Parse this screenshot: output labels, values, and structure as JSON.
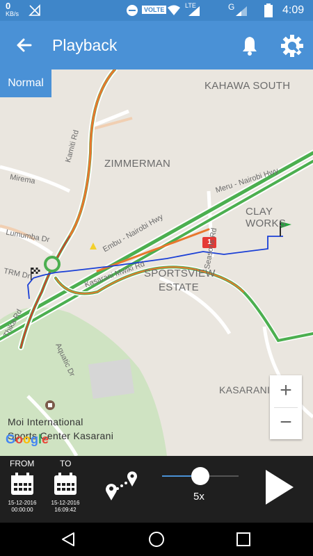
{
  "status_bar": {
    "data_rate": "0",
    "data_unit": "KB/s",
    "volte": "VOLTE",
    "lte": "LTE",
    "network": "G",
    "time": "4:09"
  },
  "app_bar": {
    "title": "Playback",
    "back_icon": "arrow-left-icon",
    "alert_icon": "bell-icon",
    "settings_icon": "gear-icon"
  },
  "map": {
    "mode_button": "Normal",
    "areas": {
      "kahawa_south": "KAHAWA SOUTH",
      "zimmerman": "ZIMMERMAN",
      "clay_works": "CLAY WORKS",
      "sportsview_line1": "SPORTSVIEW",
      "sportsview_line2": "ESTATE",
      "kasarani": "KASARANI",
      "moi_line1": "Moi International",
      "moi_line2": "Sports Center Kasarani"
    },
    "roads": {
      "kamiti": "Kamiti Rd",
      "mirema": "Mirema",
      "lumumba": "Lumumba Dr",
      "trm": "TRM Dr",
      "thika": "Thika Rd",
      "meru_nairobi": "Meru - Nairobi Hwy",
      "embu_nairobi": "Embu - Nairobi Hwy",
      "kasarani_mwiki": "Kasarani Mwiki Rd",
      "seasons": "Seasons Rd",
      "aquatic": "Aquatic Dr"
    },
    "marker_number": "1",
    "zoom_in": "+",
    "zoom_out": "−",
    "attribution": "Google"
  },
  "controls": {
    "from_label": "FROM",
    "to_label": "TO",
    "from_date": "15-12-2016",
    "from_time": "00:00:00",
    "to_date": "15-12-2016",
    "to_time": "16:09:42",
    "speed": "5x",
    "speed_slider_fraction": 0.5,
    "play_icon": "play-icon"
  },
  "colors": {
    "appbar": "#4a91d6",
    "statusbar": "#3f86c9",
    "route": "#1a3fd6",
    "traffic_green": "#4caf50",
    "traffic_orange": "#e8772e"
  }
}
